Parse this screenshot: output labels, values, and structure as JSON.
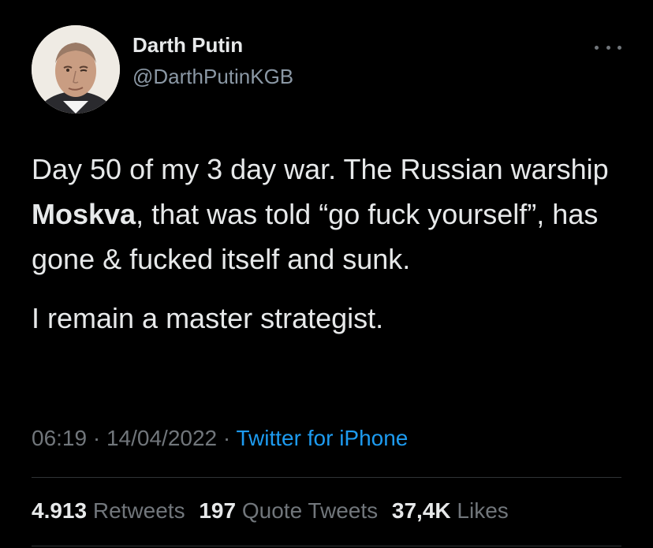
{
  "user": {
    "display_name": "Darth Putin",
    "handle": "@DarthPutinKGB",
    "avatar_icon": "profile-photo"
  },
  "tweet": {
    "text_part1": "Day 50 of my 3 day war. The Russian warship ",
    "text_bold": "Moskva",
    "text_part2": ", that was told “go fuck yourself”, has gone & fucked itself and sunk.",
    "text_para2": "I remain a master strategist."
  },
  "meta": {
    "time": "06:19",
    "sep1": " · ",
    "date": "14/04/2022",
    "sep2": " · ",
    "source": "Twitter for iPhone"
  },
  "stats": {
    "retweets_count": "4.913",
    "retweets_label": "Retweets",
    "quotes_count": "197",
    "quotes_label": "Quote Tweets",
    "likes_count": "37,4K",
    "likes_label": "Likes"
  },
  "colors": {
    "background": "#000000",
    "text": "#e7e9ea",
    "secondary": "#71767b",
    "link": "#1d9bf0",
    "divider": "#2f3336"
  }
}
